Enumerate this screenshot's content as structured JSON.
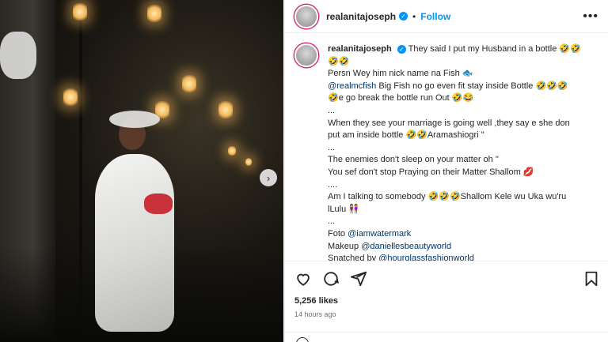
{
  "post": {
    "username": "realanitajoseph",
    "follow_label": "Follow",
    "separator": "•",
    "more_label": "•••",
    "caption": {
      "line1": "They said I put my Husband in a bottle 🤣🤣",
      "line1b": "🤣🤣",
      "line2": "Persn Wey him nick name na Fish 🐟",
      "line3_mention": "@realmcfish",
      "line3_text": " Big Fish no go even fit stay inside Bottle 🤣🤣🤣",
      "line4": "🤣e go break the bottle run Out 🤣😂",
      "line5": "...",
      "line6": "When they see your marriage is going well ,they say e she don",
      "line7": "put am inside bottle 🤣🤣Aramashiogri \"",
      "line8": "...",
      "line9": "The enemies don't sleep on your matter oh \"",
      "line10": "You sef don't stop Praying on their Matter Shallom 💋",
      "line11": "....",
      "line12": "Am I talking to somebody 🤣🤣🤣Shallom Kele wu Uka wu'ru",
      "line13": "lLulu 👭",
      "line14": "...",
      "foto_label": "Foto ",
      "foto_mention": "@iamwatermark",
      "makeup_label": "Makeup ",
      "makeup_mention": "@daniellesbeautyworld",
      "snatched_label": "Snatched by ",
      "snatched_mention": "@hourglassfashionworld"
    },
    "likes": "5,256 likes",
    "time": "14 hours ago",
    "next_arrow": "›"
  },
  "colors": {
    "accent": "#0095f6",
    "mention": "#00376b",
    "text": "#262626",
    "muted": "#737373"
  },
  "icons": [
    "heart-icon",
    "comment-icon",
    "share-icon",
    "bookmark-icon",
    "verified-icon",
    "more-icon",
    "chevron-right-icon"
  ]
}
